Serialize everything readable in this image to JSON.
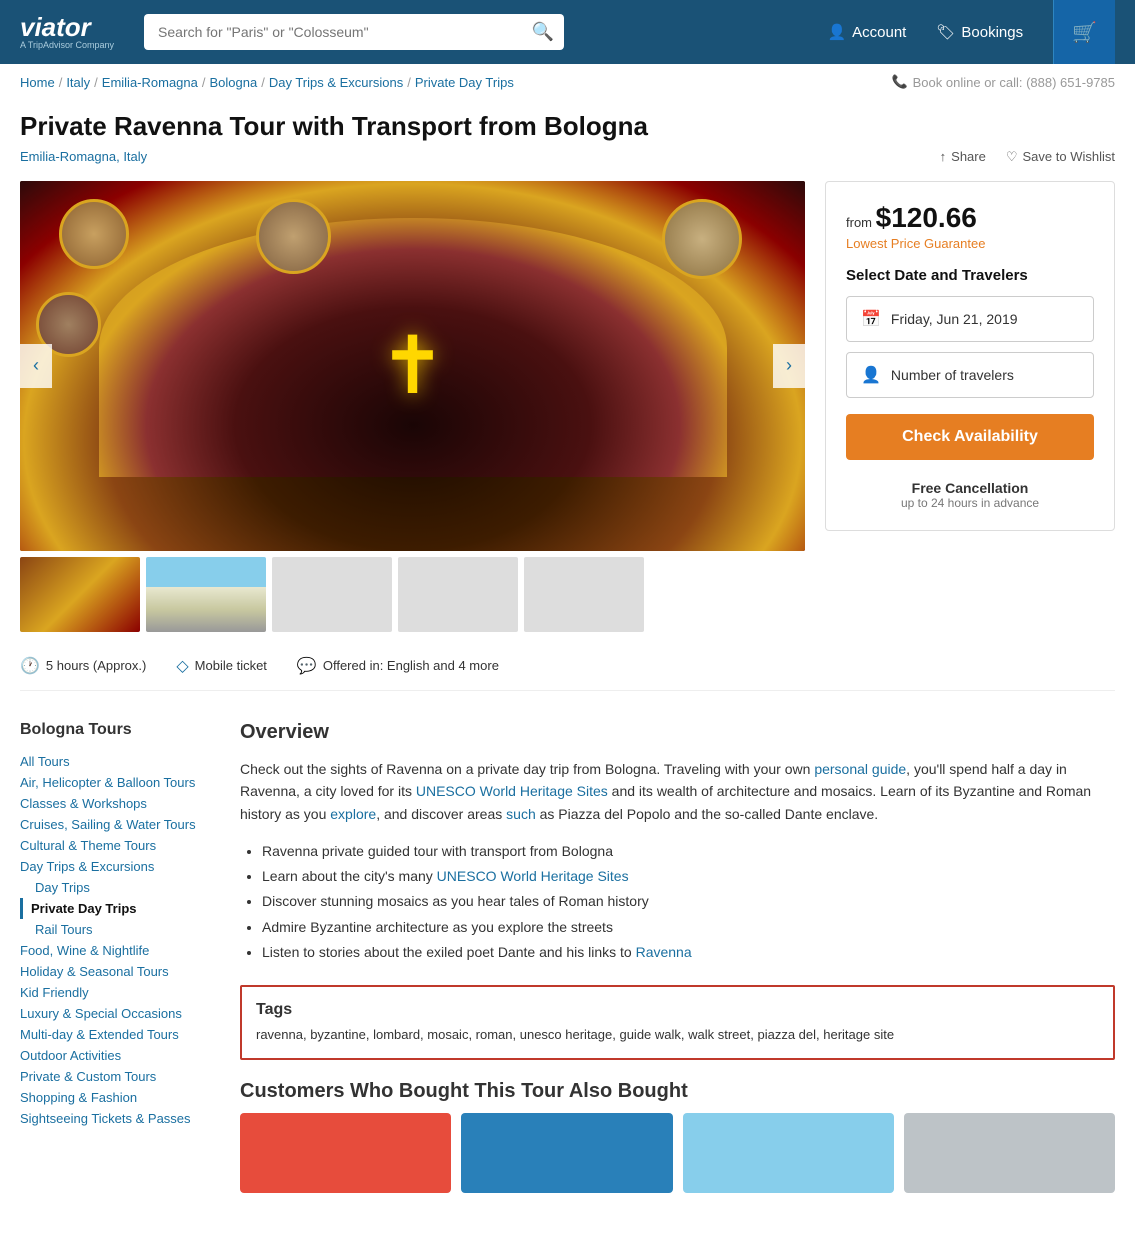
{
  "header": {
    "logo": "viator",
    "logo_sub": "A TripAdvisor Company",
    "search_placeholder": "Search for \"Paris\" or \"Colosseum\"",
    "account_label": "Account",
    "bookings_label": "Bookings",
    "phone": "Book online or call: (888) 651-9785"
  },
  "breadcrumb": {
    "items": [
      "Home",
      "Italy",
      "Emilia-Romagna",
      "Bologna",
      "Day Trips & Excursions",
      "Private Day Trips"
    ]
  },
  "tour": {
    "title": "Private Ravenna Tour with Transport from Bologna",
    "location": "Emilia-Romagna, Italy",
    "share_label": "Share",
    "wishlist_label": "Save to Wishlist"
  },
  "booking": {
    "from_label": "from",
    "price": "$120.66",
    "guarantee_label": "Lowest Price Guarantee",
    "section_label": "Select Date and Travelers",
    "date_value": "Friday, Jun 21, 2019",
    "travelers_placeholder": "Number of travelers",
    "check_btn": "Check Availability",
    "cancellation_title": "Free Cancellation",
    "cancellation_sub": "up to 24 hours in advance"
  },
  "tour_info": {
    "duration": "5 hours (Approx.)",
    "ticket_type": "Mobile ticket",
    "offered_in": "Offered in: English and 4 more"
  },
  "sidebar": {
    "title": "Bologna Tours",
    "links": [
      {
        "label": "All Tours",
        "type": "link"
      },
      {
        "label": "Air, Helicopter & Balloon Tours",
        "type": "link"
      },
      {
        "label": "Classes & Workshops",
        "type": "link"
      },
      {
        "label": "Cruises, Sailing & Water Tours",
        "type": "link"
      },
      {
        "label": "Cultural & Theme Tours",
        "type": "link"
      },
      {
        "label": "Day Trips & Excursions",
        "type": "link"
      },
      {
        "label": "Day Trips",
        "type": "sublink"
      },
      {
        "label": "Private Day Trips",
        "type": "active"
      },
      {
        "label": "Rail Tours",
        "type": "sublink"
      },
      {
        "label": "Food, Wine & Nightlife",
        "type": "link"
      },
      {
        "label": "Holiday & Seasonal Tours",
        "type": "link"
      },
      {
        "label": "Kid Friendly",
        "type": "link"
      },
      {
        "label": "Luxury & Special Occasions",
        "type": "link"
      },
      {
        "label": "Multi-day & Extended Tours",
        "type": "link"
      },
      {
        "label": "Outdoor Activities",
        "type": "link"
      },
      {
        "label": "Private & Custom Tours",
        "type": "link"
      },
      {
        "label": "Shopping & Fashion",
        "type": "link"
      },
      {
        "label": "Sightseeing Tickets & Passes",
        "type": "link"
      }
    ]
  },
  "overview": {
    "title": "Overview",
    "text": "Check out the sights of Ravenna on a private day trip from Bologna. Traveling with your own personal guide, you'll spend half a day in Ravenna, a city loved for its UNESCO World Heritage Sites and its wealth of architecture and mosaics. Learn of its Byzantine and Roman history as you explore, and discover areas such as Piazza del Popolo and the so-called Dante enclave.",
    "bullets": [
      "Ravenna private guided tour with transport from Bologna",
      "Learn about the city's many UNESCO World Heritage Sites",
      "Discover stunning mosaics as you hear tales of Roman history",
      "Admire Byzantine architecture as you explore the streets",
      "Listen to stories about the exiled poet Dante and his links to Ravenna"
    ]
  },
  "tags": {
    "title": "Tags",
    "text": "ravenna, byzantine, lombard, mosaic, roman, unesco heritage, guide walk, walk street, piazza del, heritage site"
  },
  "customers_section": {
    "title": "Customers Who Bought This Tour Also Bought"
  }
}
